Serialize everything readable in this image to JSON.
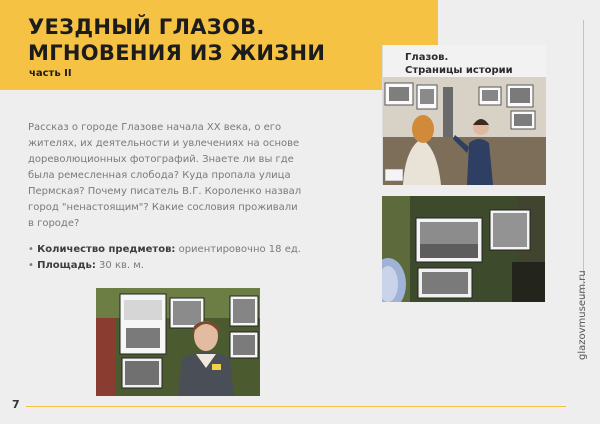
{
  "header": {
    "title_line1": "УЕЗДНЫЙ ГЛАЗОВ.",
    "title_line2": "МГНОВЕНИЯ ИЗ ЖИЗНИ",
    "subtitle": "часть II",
    "accent_color": "#f5c244"
  },
  "intro": {
    "lines": [
      "Рассказ о городе Глазове начала XX века, о его",
      "жителях, их деятельности и увлечениях на основе",
      "дореволюционных фотографий. Знаете ли вы где",
      "была ремесленная слобода? Куда пропала улица",
      "Пермская? Почему писатель В.Г. Короленко назвал",
      "город \"ненастоящим\"? Какие сословия проживали",
      "в городе?"
    ]
  },
  "facts": [
    {
      "bullet": "•",
      "label": "Количество предметов:",
      "value": " ориентировочно 18 ед."
    },
    {
      "bullet": "•",
      "label": "Площадь:",
      "value": " 30 кв. м."
    }
  ],
  "photo_top": {
    "caption_line1": "Глазов.",
    "caption_line2": "Страницы истории"
  },
  "footer": {
    "page_number": "7",
    "site": "glazovmuseum.ru"
  }
}
